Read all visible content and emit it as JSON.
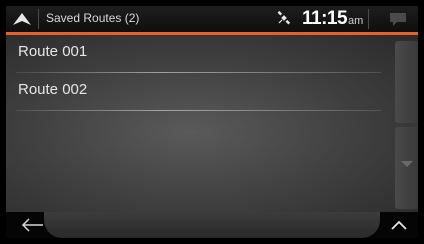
{
  "header": {
    "title": "Saved Routes (2)",
    "time": "11:15",
    "ampm": "am",
    "icons": [
      "navigate-up-icon",
      "satellite-icon",
      "message-icon"
    ]
  },
  "routes": [
    {
      "label": "Route 001"
    },
    {
      "label": "Route 002"
    }
  ],
  "footer": {
    "icons": [
      "back-arrow-icon",
      "chevron-up-icon"
    ]
  },
  "colors": {
    "accent": "#e8602a",
    "background": "#3e3e3e"
  }
}
